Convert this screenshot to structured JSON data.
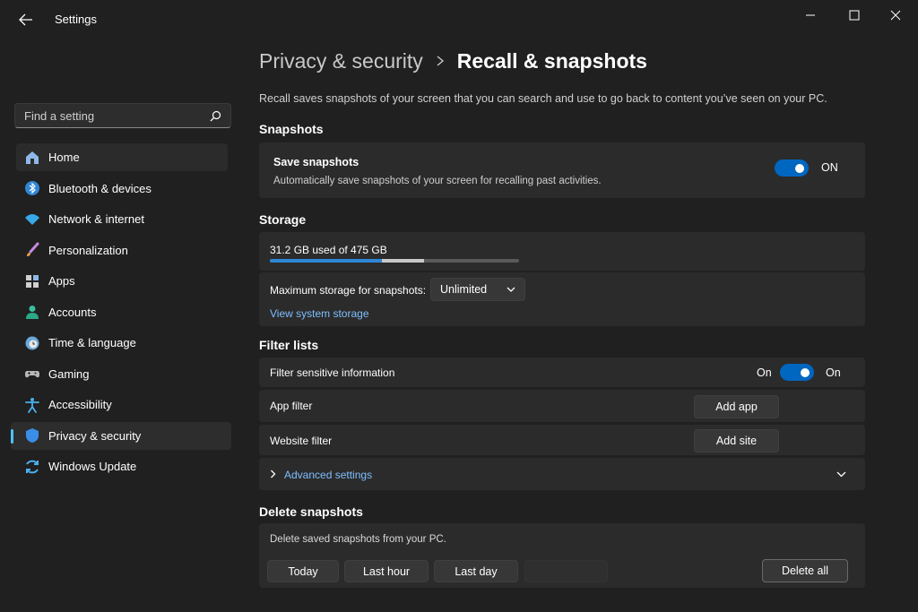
{
  "window": {
    "title": "Settings",
    "minimize_glyph": "—",
    "maximize_glyph": "☐",
    "close_glyph": "✕"
  },
  "search": {
    "placeholder": "Find a setting"
  },
  "sidebar": {
    "items": [
      {
        "label": "Home",
        "icon": "home-icon"
      },
      {
        "label": "Bluetooth & devices",
        "icon": "bluetooth-icon"
      },
      {
        "label": "Network & internet",
        "icon": "wifi-icon"
      },
      {
        "label": "Personalization",
        "icon": "brush-icon"
      },
      {
        "label": "Apps",
        "icon": "apps-icon"
      },
      {
        "label": "Accounts",
        "icon": "person-icon"
      },
      {
        "label": "Time & language",
        "icon": "globe-clock-icon"
      },
      {
        "label": "Gaming",
        "icon": "gamepad-icon"
      },
      {
        "label": "Accessibility",
        "icon": "accessibility-icon"
      },
      {
        "label": "Privacy & security",
        "icon": "shield-icon"
      },
      {
        "label": "Windows Update",
        "icon": "update-icon"
      }
    ],
    "selected": "Privacy & security"
  },
  "breadcrumb": {
    "parent": "Privacy & security",
    "current": "Recall & snapshots"
  },
  "intro": "Recall saves snapshots of your screen that you can search and use to go back to content you’ve seen on your PC.",
  "snapshots": {
    "heading": "Snapshots",
    "save_title": "Save snapshots",
    "save_desc": "Automatically save snapshots of your screen for recalling past activities.",
    "toggle_state": "ON"
  },
  "storage": {
    "heading": "Storage",
    "used_text": "31.2 GB used of 475 GB",
    "segments": [
      {
        "fraction": 0.45,
        "color": "#2f86d6"
      },
      {
        "fraction": 0.17,
        "color": "#c8c8c8"
      }
    ],
    "max_label": "Maximum storage for snapshots:",
    "max_value": "Unlimited",
    "view_link": "View system storage"
  },
  "filters": {
    "heading": "Filter lists",
    "sensitive_label": "Filter sensitive information",
    "sensitive_left": "On",
    "sensitive_right": "On",
    "app_filter_label": "App filter",
    "add_app": "Add app",
    "website_filter_label": "Website filter",
    "add_site": "Add site",
    "advanced": "Advanced settings"
  },
  "delete": {
    "heading": "Delete snapshots",
    "desc": "Delete saved snapshots from your PC.",
    "today": "Today",
    "last_hour": "Last hour",
    "last_day": "Last day",
    "delete_all": "Delete all"
  },
  "colors": {
    "accent": "#0067c0",
    "link": "#7fbfff",
    "selected_indicator": "#4cc2ff"
  }
}
